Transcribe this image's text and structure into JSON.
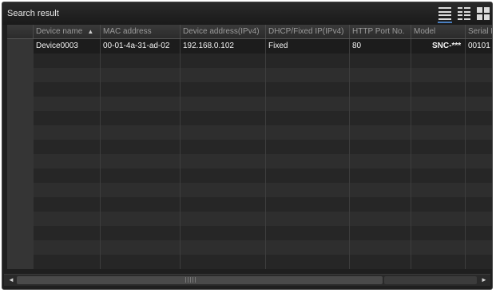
{
  "window": {
    "title": "Search result"
  },
  "view_buttons": [
    {
      "name": "list-view-icon",
      "active": true
    },
    {
      "name": "detail-view-icon",
      "active": false
    },
    {
      "name": "tile-view-icon",
      "active": false
    }
  ],
  "table": {
    "columns": [
      {
        "key": "device_name",
        "label": "Device name",
        "sorted": true,
        "sort_dir": "asc"
      },
      {
        "key": "mac",
        "label": "MAC address"
      },
      {
        "key": "ipv4",
        "label": "Device address(IPv4)"
      },
      {
        "key": "dhcp",
        "label": "DHCP/Fixed IP(IPv4)"
      },
      {
        "key": "port",
        "label": "HTTP Port No."
      },
      {
        "key": "model",
        "label": "Model"
      },
      {
        "key": "serial",
        "label": "Serial No."
      }
    ],
    "rows": [
      {
        "device_name": "Device0003",
        "mac": "00-01-4a-31-ad-02",
        "ipv4": "192.168.0.102",
        "dhcp": "Fixed",
        "port": "80",
        "model": "SNC-***",
        "serial": "00101"
      }
    ],
    "empty_rows": 15,
    "sort_arrow_glyph": "▲"
  },
  "scrollbar": {
    "left_arrow": "◄",
    "right_arrow": "►"
  }
}
